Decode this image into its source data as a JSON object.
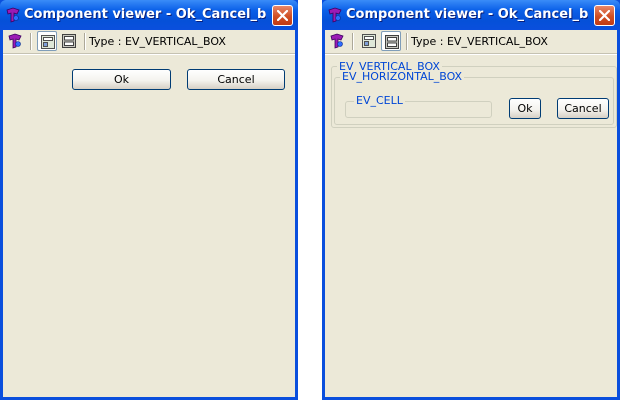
{
  "windows": [
    {
      "title": "Component viewer - Ok_Cancel_butt...",
      "type_label": "Type : EV_VERTICAL_BOX",
      "ok_label": "Ok",
      "cancel_label": "Cancel"
    },
    {
      "title": "Component viewer - Ok_Cancel_butt...",
      "type_label": "Type : EV_VERTICAL_BOX",
      "vertical_box_label": "EV_VERTICAL_BOX",
      "horizontal_box_label": "EV_HORIZONTAL_BOX",
      "cell_label": "EV_CELL",
      "ok_label": "Ok",
      "cancel_label": "Cancel"
    }
  ],
  "icons": [
    "app-icon",
    "close-icon",
    "tool-icon",
    "display-view-icon",
    "layout-view-icon"
  ],
  "colors": {
    "title_bar": "#0a4fdd",
    "close_button": "#d04f23",
    "window_background": "#ece9d8",
    "group_label": "#0046d5",
    "button_border": "#003c74"
  }
}
